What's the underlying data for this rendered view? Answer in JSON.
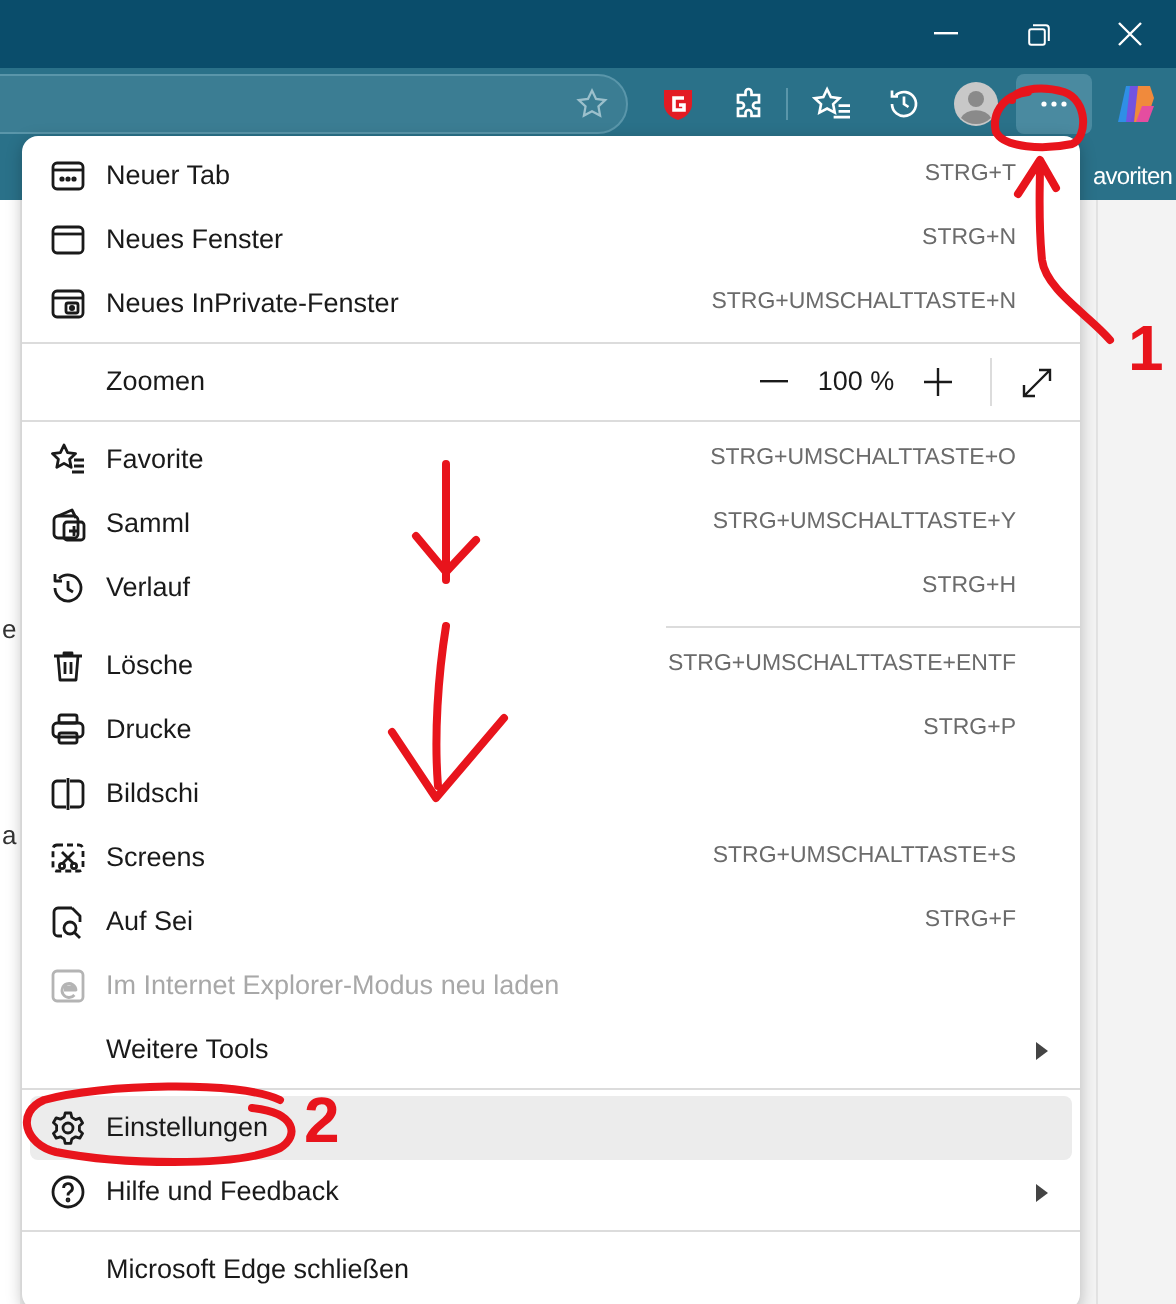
{
  "favorites_bar": {
    "label": "avoriten"
  },
  "page_fragments": [
    "e",
    "a"
  ],
  "menu": [
    {
      "kind": "item",
      "label": "Neuer Tab",
      "shortcut": "STRG+T",
      "selected": false,
      "disabled": false
    },
    {
      "kind": "item",
      "label": "Neues Fenster",
      "shortcut": "STRG+N",
      "selected": false,
      "disabled": false
    },
    {
      "kind": "item",
      "label": "Neues InPrivate-Fenster",
      "shortcut": "STRG+UMSCHALTTASTE+N",
      "selected": false,
      "disabled": false
    },
    {
      "kind": "divider"
    },
    {
      "kind": "zoom",
      "label": "Zoomen",
      "value": "100 %"
    },
    {
      "kind": "divider"
    },
    {
      "kind": "item",
      "label": "Favorite",
      "shortcut": "STRG+UMSCHALTTASTE+O",
      "selected": false,
      "disabled": false
    },
    {
      "kind": "item",
      "label": "Samml",
      "shortcut": "STRG+UMSCHALTTASTE+Y",
      "selected": false,
      "disabled": false
    },
    {
      "kind": "item",
      "label": "Verlauf",
      "shortcut": "STRG+H",
      "selected": false,
      "disabled": false
    },
    {
      "kind": "divider",
      "partial": true
    },
    {
      "kind": "item",
      "label": "Lösche",
      "shortcut": "STRG+UMSCHALTTASTE+ENTF",
      "selected": false,
      "disabled": false
    },
    {
      "kind": "item",
      "label": "Drucke",
      "shortcut": "STRG+P",
      "selected": false,
      "disabled": false
    },
    {
      "kind": "item",
      "label": "Bildschi",
      "selected": false,
      "disabled": false
    },
    {
      "kind": "item",
      "label": "Screens",
      "shortcut": "STRG+UMSCHALTTASTE+S",
      "selected": false,
      "disabled": false
    },
    {
      "kind": "item",
      "label": "Auf Sei",
      "shortcut": "STRG+F",
      "selected": false,
      "disabled": false
    },
    {
      "kind": "item",
      "label": "Im Internet Explorer-Modus neu laden",
      "selected": false,
      "disabled": true
    },
    {
      "kind": "item",
      "label": "Weitere Tools",
      "submenu": true,
      "selected": false,
      "disabled": false
    },
    {
      "kind": "divider"
    },
    {
      "kind": "item",
      "label": "Einstellungen",
      "selected": true,
      "disabled": false
    },
    {
      "kind": "item",
      "label": "Hilfe und Feedback",
      "submenu": true,
      "selected": false,
      "disabled": false
    },
    {
      "kind": "divider"
    },
    {
      "kind": "item",
      "label": "Microsoft Edge schließen",
      "selected": false,
      "disabled": false
    }
  ],
  "annotations": {
    "step_labels": [
      "1",
      "2"
    ]
  }
}
